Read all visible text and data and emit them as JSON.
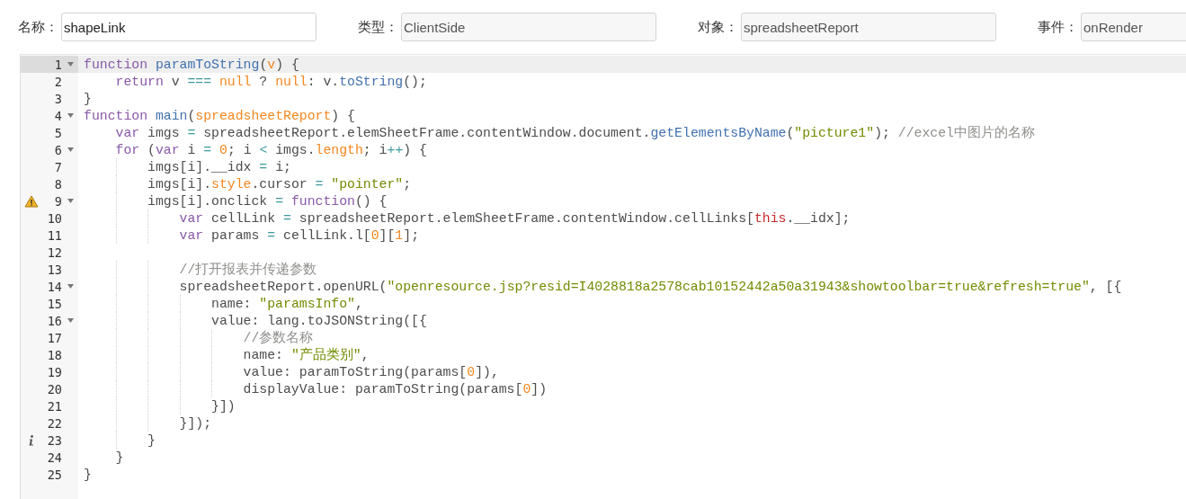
{
  "fields": [
    {
      "label": "名称：",
      "value": "shapeLink",
      "disabled": false
    },
    {
      "label": "类型：",
      "value": "ClientSide",
      "disabled": true
    },
    {
      "label": "对象：",
      "value": "spreadsheetReport",
      "disabled": true
    },
    {
      "label": "事件：",
      "value": "onRender",
      "disabled": true
    }
  ],
  "editor": {
    "lines": [
      {
        "number": "1",
        "kind": "plain",
        "foldable": true,
        "active": true,
        "tokens": [
          {
            "kind": "keyword",
            "text": "function"
          },
          {
            "kind": "def",
            "text": " paramToString"
          },
          {
            "kind": "plain",
            "text": "("
          },
          {
            "kind": "atom",
            "text": "v"
          },
          {
            "kind": "plain",
            "text": ") {"
          }
        ]
      },
      {
        "number": "2",
        "kind": "plain",
        "foldable": false,
        "active": false,
        "tokens": [
          {
            "kind": "keyword",
            "text": "    return"
          },
          {
            "kind": "plain",
            "text": " v "
          },
          {
            "kind": "operator",
            "text": "==="
          },
          {
            "kind": "atom",
            "text": " null"
          },
          {
            "kind": "plain",
            "text": " ? "
          },
          {
            "kind": "atom",
            "text": "null"
          },
          {
            "kind": "plain",
            "text": ": v."
          },
          {
            "kind": "def",
            "text": "toString"
          },
          {
            "kind": "plain",
            "text": "();"
          }
        ]
      },
      {
        "number": "3",
        "kind": "plain",
        "foldable": false,
        "active": false,
        "tokens": [
          {
            "kind": "plain",
            "text": "}"
          }
        ]
      },
      {
        "number": "4",
        "kind": "plain",
        "foldable": true,
        "active": false,
        "tokens": [
          {
            "kind": "keyword",
            "text": "function"
          },
          {
            "kind": "def",
            "text": " main"
          },
          {
            "kind": "plain",
            "text": "("
          },
          {
            "kind": "atom",
            "text": "spreadsheetReport"
          },
          {
            "kind": "plain",
            "text": ") {"
          }
        ]
      },
      {
        "number": "5",
        "kind": "plain",
        "foldable": false,
        "active": false,
        "tokens": [
          {
            "kind": "keyword",
            "text": "    var"
          },
          {
            "kind": "plain",
            "text": " imgs "
          },
          {
            "kind": "operator",
            "text": "="
          },
          {
            "kind": "plain",
            "text": " spreadsheetReport.elemSheetFrame.contentWindow.document."
          },
          {
            "kind": "def",
            "text": "getElementsByName"
          },
          {
            "kind": "plain",
            "text": "("
          },
          {
            "kind": "string",
            "text": "\"picture1\""
          },
          {
            "kind": "plain",
            "text": "); "
          },
          {
            "kind": "comment",
            "text": "//excel中图片的名称"
          }
        ]
      },
      {
        "number": "6",
        "kind": "plain",
        "foldable": true,
        "active": false,
        "tokens": [
          {
            "kind": "keyword",
            "text": "    for"
          },
          {
            "kind": "plain",
            "text": " ("
          },
          {
            "kind": "keyword",
            "text": "var"
          },
          {
            "kind": "plain",
            "text": " i "
          },
          {
            "kind": "operator",
            "text": "="
          },
          {
            "kind": "atom",
            "text": " 0"
          },
          {
            "kind": "plain",
            "text": "; i "
          },
          {
            "kind": "operator",
            "text": "<"
          },
          {
            "kind": "plain",
            "text": " imgs."
          },
          {
            "kind": "atom",
            "text": "length"
          },
          {
            "kind": "plain",
            "text": "; i"
          },
          {
            "kind": "operator",
            "text": "++"
          },
          {
            "kind": "plain",
            "text": ") {"
          }
        ]
      },
      {
        "number": "7",
        "kind": "plain",
        "foldable": false,
        "active": false,
        "tokens": [
          {
            "kind": "plain",
            "text": "        imgs[i].__idx "
          },
          {
            "kind": "operator",
            "text": "="
          },
          {
            "kind": "plain",
            "text": " i;"
          }
        ]
      },
      {
        "number": "8",
        "kind": "plain",
        "foldable": false,
        "active": false,
        "tokens": [
          {
            "kind": "plain",
            "text": "        imgs[i]."
          },
          {
            "kind": "atom",
            "text": "style"
          },
          {
            "kind": "plain",
            "text": ".cursor "
          },
          {
            "kind": "operator",
            "text": "="
          },
          {
            "kind": "string",
            "text": " \"pointer\""
          },
          {
            "kind": "plain",
            "text": ";"
          }
        ]
      },
      {
        "number": "9",
        "kind": "warning",
        "foldable": true,
        "active": false,
        "tokens": [
          {
            "kind": "plain",
            "text": "        imgs[i].onclick "
          },
          {
            "kind": "operator",
            "text": "="
          },
          {
            "kind": "keyword",
            "text": " function"
          },
          {
            "kind": "plain",
            "text": "() {"
          }
        ]
      },
      {
        "number": "10",
        "kind": "plain",
        "foldable": false,
        "active": false,
        "tokens": [
          {
            "kind": "keyword",
            "text": "            var"
          },
          {
            "kind": "plain",
            "text": " cellLink "
          },
          {
            "kind": "operator",
            "text": "="
          },
          {
            "kind": "plain",
            "text": " spreadsheetReport.elemSheetFrame.contentWindow.cellLinks["
          },
          {
            "kind": "this",
            "text": "this"
          },
          {
            "kind": "plain",
            "text": ".__idx];"
          }
        ]
      },
      {
        "number": "11",
        "kind": "plain",
        "foldable": false,
        "active": false,
        "tokens": [
          {
            "kind": "keyword",
            "text": "            var"
          },
          {
            "kind": "plain",
            "text": " params "
          },
          {
            "kind": "operator",
            "text": "="
          },
          {
            "kind": "plain",
            "text": " cellLink.l["
          },
          {
            "kind": "atom",
            "text": "0"
          },
          {
            "kind": "plain",
            "text": "]["
          },
          {
            "kind": "atom",
            "text": "1"
          },
          {
            "kind": "plain",
            "text": "];"
          }
        ]
      },
      {
        "number": "12",
        "kind": "plain",
        "foldable": false,
        "active": false
      },
      {
        "number": "13",
        "kind": "plain",
        "foldable": false,
        "active": false,
        "tokens": [
          {
            "kind": "comment",
            "text": "            //打开报表并传递参数"
          }
        ]
      },
      {
        "number": "14",
        "kind": "plain",
        "foldable": true,
        "active": false,
        "tokens": [
          {
            "kind": "plain",
            "text": "            spreadsheetReport.openURL("
          },
          {
            "kind": "string",
            "text": "\"openresource.jsp?resid=I4028818a2578cab10152442a50a31943&showtoolbar=true&refresh=true\""
          },
          {
            "kind": "plain",
            "text": ", [{"
          }
        ]
      },
      {
        "number": "15",
        "kind": "plain",
        "foldable": false,
        "active": false,
        "tokens": [
          {
            "kind": "plain",
            "text": "                name: "
          },
          {
            "kind": "string",
            "text": "\"paramsInfo\""
          },
          {
            "kind": "plain",
            "text": ","
          }
        ]
      },
      {
        "number": "16",
        "kind": "plain",
        "foldable": true,
        "active": false,
        "tokens": [
          {
            "kind": "plain",
            "text": "                value: lang.toJSONString([{"
          }
        ]
      },
      {
        "number": "17",
        "kind": "plain",
        "foldable": false,
        "active": false,
        "tokens": [
          {
            "kind": "comment",
            "text": "                    //参数名称"
          }
        ]
      },
      {
        "number": "18",
        "kind": "plain",
        "foldable": false,
        "active": false,
        "tokens": [
          {
            "kind": "plain",
            "text": "                    name: "
          },
          {
            "kind": "string",
            "text": "\"产品类别\""
          },
          {
            "kind": "plain",
            "text": ","
          }
        ]
      },
      {
        "number": "19",
        "kind": "plain",
        "foldable": false,
        "active": false,
        "tokens": [
          {
            "kind": "plain",
            "text": "                    value: paramToString(params["
          },
          {
            "kind": "atom",
            "text": "0"
          },
          {
            "kind": "plain",
            "text": "]),"
          }
        ]
      },
      {
        "number": "20",
        "kind": "plain",
        "foldable": false,
        "active": false,
        "tokens": [
          {
            "kind": "plain",
            "text": "                    displayValue: paramToString(params["
          },
          {
            "kind": "atom",
            "text": "0"
          },
          {
            "kind": "plain",
            "text": "])"
          }
        ]
      },
      {
        "number": "21",
        "kind": "plain",
        "foldable": false,
        "active": false,
        "tokens": [
          {
            "kind": "plain",
            "text": "                }])"
          }
        ]
      },
      {
        "number": "22",
        "kind": "plain",
        "foldable": false,
        "active": false,
        "tokens": [
          {
            "kind": "plain",
            "text": "            }]);"
          }
        ]
      },
      {
        "number": "23",
        "kind": "info",
        "foldable": false,
        "active": false,
        "tokens": [
          {
            "kind": "plain",
            "text": "        }"
          }
        ]
      },
      {
        "number": "24",
        "kind": "plain",
        "foldable": false,
        "active": false,
        "tokens": [
          {
            "kind": "plain",
            "text": "    }"
          }
        ]
      },
      {
        "number": "25",
        "kind": "plain",
        "foldable": false,
        "active": false,
        "tokens": [
          {
            "kind": "plain",
            "text": "}"
          }
        ]
      }
    ]
  }
}
